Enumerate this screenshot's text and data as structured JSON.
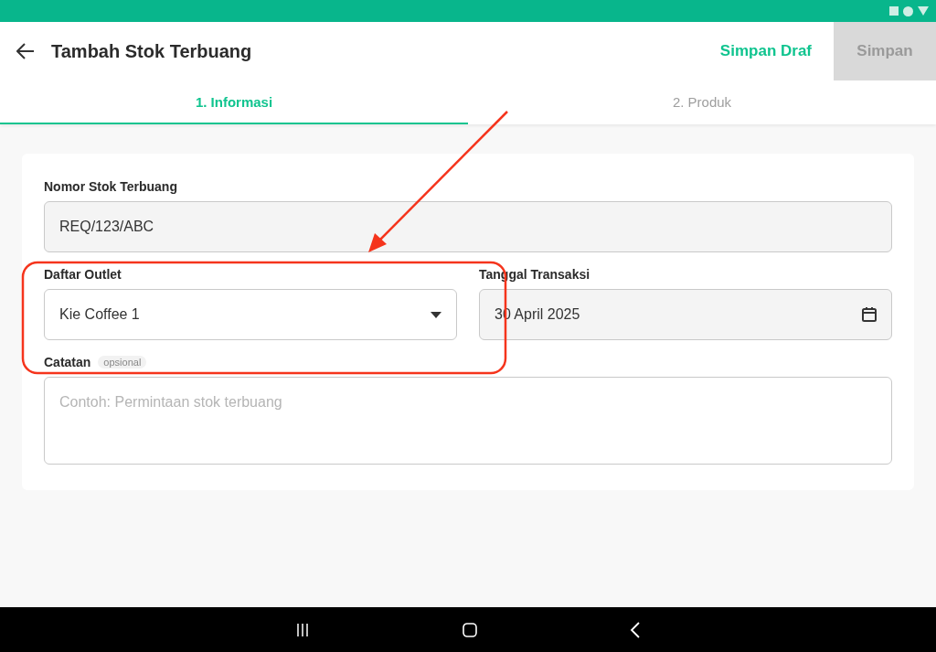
{
  "header": {
    "title": "Tambah Stok Terbuang",
    "draft_button": "Simpan Draf",
    "save_button": {
      "label": "Simpan",
      "disabled": true
    }
  },
  "tabs": [
    {
      "label": "1. Informasi",
      "selected": true
    },
    {
      "label": "2. Produk",
      "selected": false
    }
  ],
  "form": {
    "stock_number": {
      "label": "Nomor Stok Terbuang",
      "value": "REQ/123/ABC"
    },
    "outlet": {
      "label": "Daftar Outlet",
      "value": "Kie Coffee 1"
    },
    "date": {
      "label": "Tanggal Transaksi",
      "value": "30 April 2025"
    },
    "notes": {
      "label": "Catatan",
      "badge": "opsional",
      "placeholder": "Contoh: Permintaan stok terbuang"
    }
  }
}
